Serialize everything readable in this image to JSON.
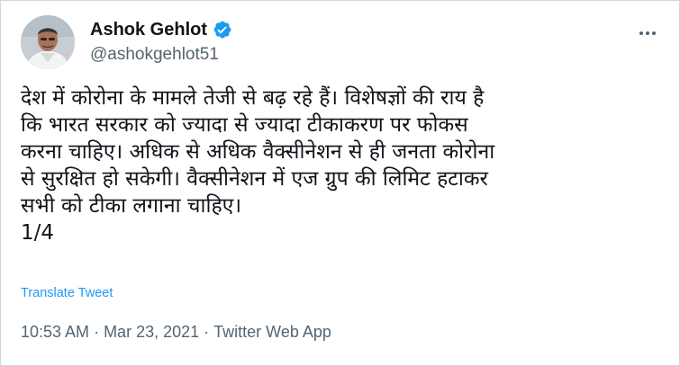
{
  "author": {
    "display_name": "Ashok Gehlot",
    "handle": "@ashokgehlot51",
    "verified_icon": "verified-badge-icon"
  },
  "more_icon": "more-horizontal-icon",
  "tweet": {
    "text": "देश में कोरोना के मामले तेजी से बढ़ रहे हैं। विशेषज्ञों की राय है\nकि भारत सरकार को ज्यादा से ज्यादा टीकाकरण पर फोकस\nकरना चाहिए। अधिक से अधिक वैक्सीनेशन से ही जनता कोरोना\nसे सुरक्षित हो सकेगी। वैक्सीनेशन में एज ग्रुप की लिमिट हटाकर\nसभी को टीका लगाना चाहिए।\n1/4",
    "translate_label": "Translate Tweet"
  },
  "meta": {
    "time": "10:53 AM",
    "separator": "·",
    "date": "Mar 23, 2021",
    "source": "Twitter Web App"
  },
  "colors": {
    "text": "#0f1419",
    "secondary": "#536471",
    "link": "#1d9bf0",
    "verified": "#1d9bf0",
    "border": "#cfd9de"
  }
}
